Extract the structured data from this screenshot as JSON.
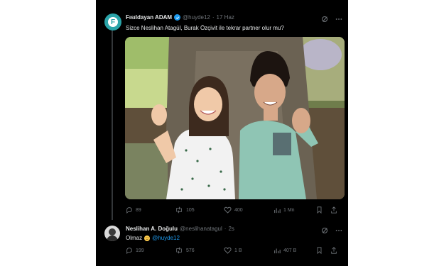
{
  "tweet": {
    "author_name": "Fısıldayan ADAM",
    "handle": "@huyde12",
    "separator": "·",
    "time": "17 Haz",
    "avatar_letter": "F",
    "text": "Sizce Neslihan Atagül, Burak Özçivit ile tekrar partner olur mu?",
    "stats": {
      "replies": "89",
      "retweets": "105",
      "likes": "400",
      "views": "1 Mn"
    }
  },
  "reply": {
    "author_name": "Neslihan A. Doğulu",
    "handle": "@neslihanatagul",
    "separator": "·",
    "time": "2s",
    "text": "Olmaz",
    "mention": "@huyde12",
    "stats": {
      "replies": "199",
      "retweets": "576",
      "likes": "1 B",
      "views": "407 B"
    }
  },
  "colors": {
    "background": "#000000",
    "accent": "#1d9bf0",
    "text": "#e7e9ea",
    "muted": "#71767b"
  },
  "icons": [
    "grok-icon",
    "more-icon",
    "reply-icon",
    "retweet-icon",
    "like-icon",
    "views-icon",
    "bookmark-icon",
    "share-icon",
    "verified-icon"
  ]
}
